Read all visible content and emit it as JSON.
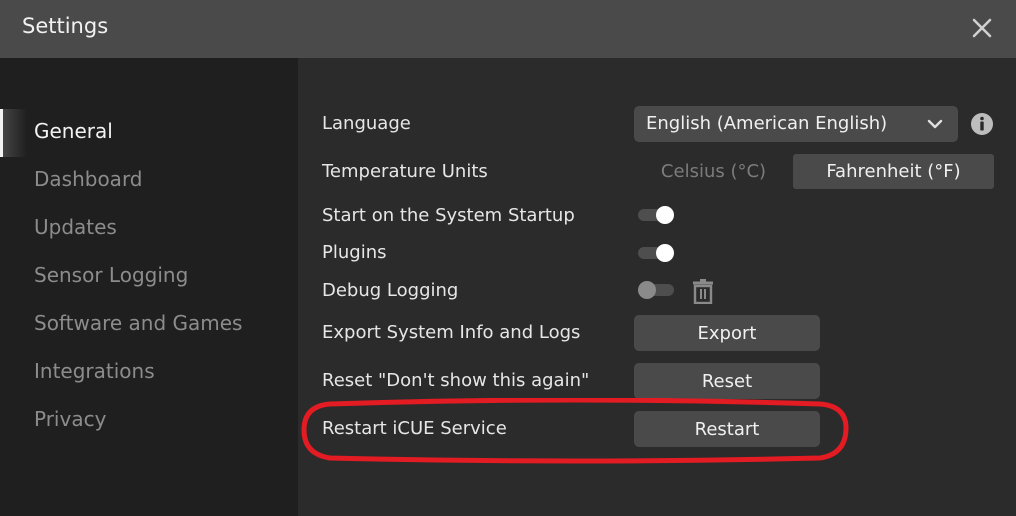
{
  "window": {
    "title": "Settings",
    "close_icon": "close-icon"
  },
  "sidebar": {
    "items": [
      {
        "label": "General",
        "active": true
      },
      {
        "label": "Dashboard",
        "active": false
      },
      {
        "label": "Updates",
        "active": false
      },
      {
        "label": "Sensor Logging",
        "active": false
      },
      {
        "label": "Software and Games",
        "active": false
      },
      {
        "label": "Integrations",
        "active": false
      },
      {
        "label": "Privacy",
        "active": false
      }
    ]
  },
  "general": {
    "language": {
      "label": "Language",
      "value": "English (American English)",
      "icon": "chevron-down-icon",
      "info_icon": "info-icon"
    },
    "temperature": {
      "label": "Temperature Units",
      "options": [
        "Celsius (°C)",
        "Fahrenheit (°F)"
      ],
      "selected": "Fahrenheit (°F)"
    },
    "startup": {
      "label": "Start on the System Startup",
      "enabled": true
    },
    "plugins": {
      "label": "Plugins",
      "enabled": true
    },
    "debug_logging": {
      "label": "Debug Logging",
      "enabled": false,
      "delete_icon": "trash-icon"
    },
    "export": {
      "label": "Export System Info and Logs",
      "button": "Export"
    },
    "reset": {
      "label": "Reset \"Don't show this again\"",
      "button": "Reset"
    },
    "restart": {
      "label": "Restart iCUE Service",
      "button": "Restart"
    }
  },
  "annotation": {
    "color": "#e31b23",
    "target": "restart-row"
  },
  "colors": {
    "titlebar": "#4a4a4a",
    "sidebar": "#1f1f1f",
    "content": "#2b2b2b",
    "button": "#4a4a4a"
  }
}
